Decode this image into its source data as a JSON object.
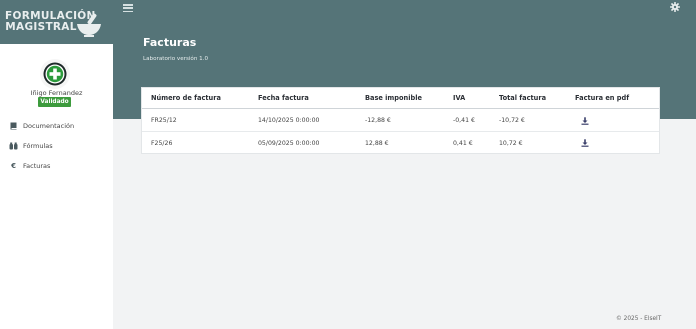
{
  "brand": {
    "line1": "FORMULACIÓN",
    "line2": "MAGISTRAL"
  },
  "user": {
    "name": "Iñigo Fernandez",
    "status": "Validado"
  },
  "nav": [
    {
      "label": "Documentación",
      "icon": "book-icon"
    },
    {
      "label": "Fórmulas",
      "icon": "bottles-icon"
    },
    {
      "label": "Facturas",
      "icon": "euro-icon"
    }
  ],
  "header": {
    "title": "Facturas",
    "subtitle": "Laboratorio versión 1.0"
  },
  "table": {
    "columns": [
      "Número de factura",
      "Fecha factura",
      "Base imponible",
      "IVA",
      "Total factura",
      "Factura en pdf"
    ],
    "rows": [
      [
        "FR25/12",
        "14/10/2025 0:00:00",
        "-12,88 €",
        "-0,41 €",
        "-10,72 €"
      ],
      [
        "F25/26",
        "05/09/2025 0:00:00",
        "12,88 €",
        "0,41 €",
        "10,72 €"
      ]
    ]
  },
  "footer": {
    "text": "© 2025 - ElseIT"
  },
  "colors": {
    "header_teal": "#557478",
    "badge_green": "#3d9b3d",
    "download_icon": "#3a3f6a"
  }
}
